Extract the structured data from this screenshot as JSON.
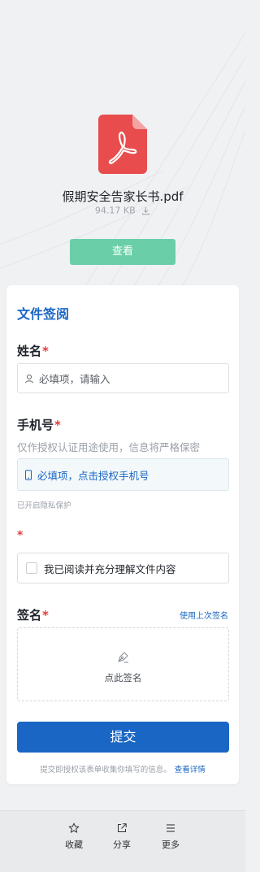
{
  "file": {
    "name": "假期安全告家长书.pdf",
    "size": "94.17 KB",
    "view_label": "查看"
  },
  "form": {
    "title": "文件签阅",
    "name_field": {
      "label": "姓名",
      "required_mark": "*",
      "placeholder": "必填项，请输入"
    },
    "phone_field": {
      "label": "手机号",
      "required_mark": "*",
      "hint": "仅作授权认证用途使用，信息将严格保密",
      "action": "必填项，点击授权手机号",
      "privacy_note": "已开启隐私保护"
    },
    "agree_field": {
      "required_mark": "*",
      "checkbox_label": "我已阅读并充分理解文件内容"
    },
    "sign_field": {
      "label": "签名",
      "required_mark": "*",
      "use_last": "使用上次签名",
      "sign_prompt": "点此签名"
    },
    "submit_label": "提交",
    "footer_note": "提交即授权该表单收集你填写的信息。",
    "footer_link": "查看详情"
  },
  "bottom_nav": [
    {
      "label": "收藏",
      "icon": "star-icon"
    },
    {
      "label": "分享",
      "icon": "share-icon"
    },
    {
      "label": "更多",
      "icon": "menu-icon"
    }
  ],
  "colors": {
    "accent": "#1a66c4",
    "view_button": "#6acfa9",
    "required": "#e03e3e",
    "pdf_red": "#e84c4c"
  }
}
